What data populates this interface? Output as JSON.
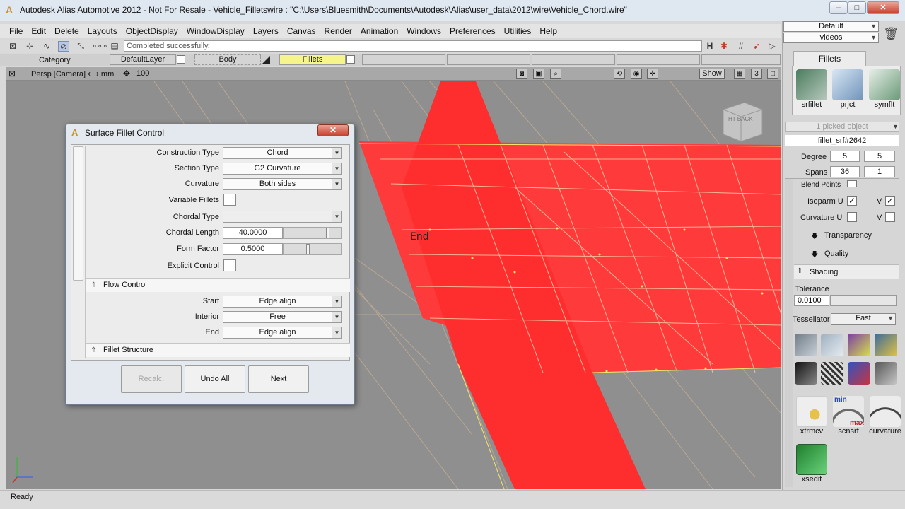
{
  "window": {
    "title": "Autodesk Alias Automotive 2012 - Not For Resale - Vehicle_Filletswire : \"C:\\Users\\Bluesmith\\Documents\\Autodesk\\Alias\\user_data\\2012\\wire\\Vehicle_Chord.wire\"",
    "minimize": "–",
    "maximize": "□",
    "close": "✕"
  },
  "menu": [
    "File",
    "Edit",
    "Delete",
    "Layouts",
    "ObjectDisplay",
    "WindowDisplay",
    "Layers",
    "Canvas",
    "Render",
    "Animation",
    "Windows",
    "Preferences",
    "Utilities",
    "Help"
  ],
  "toolbar": {
    "message": "Completed successfully."
  },
  "layers": {
    "category": "Category",
    "items": [
      "DefaultLayer",
      "Body",
      "Fillets"
    ]
  },
  "viewport": {
    "label": "Persp [Camera]  ⟷ mm",
    "zoom": "100",
    "show_button": "Show",
    "count": "3",
    "annotation": "End",
    "viewcube_text": "HT  BACK"
  },
  "status": {
    "text": "Ready"
  },
  "right_panel": {
    "shelf_default": "Default",
    "shelf_videos": "videos",
    "tab": "Fillets",
    "tools_top": [
      {
        "label": "srfillet",
        "color": "#5f8d6e"
      },
      {
        "label": "prjct",
        "color": "#8fb0cf"
      },
      {
        "label": "symflt",
        "color": "#7fa58a"
      }
    ],
    "picked": "1 picked object",
    "object_name": "fillet_srf#2642",
    "degree_label": "Degree",
    "degree_u": "5",
    "degree_v": "5",
    "spans_label": "Spans",
    "spans_u": "36",
    "spans_v": "1",
    "blend_points": "Blend Points",
    "isoparm_u": "Isoparm U",
    "isoparm_v": "V",
    "curvature_u": "Curvature U",
    "curvature_v": "V",
    "transparency": "Transparency",
    "quality": "Quality",
    "shading": "Shading",
    "tolerance_label": "Tolerance",
    "tolerance": "0.0100",
    "tessellator_label": "Tessellator",
    "tessellator": "Fast",
    "tools_bottom": [
      {
        "label": "xfrmcv"
      },
      {
        "label": "scnsrf"
      },
      {
        "label": "curvature"
      },
      {
        "label": "xsedit"
      }
    ],
    "scnsrf_min": "min",
    "scnsrf_max": "max"
  },
  "dialog": {
    "title": "Surface Fillet Control",
    "close": "✕",
    "fields": {
      "construction_type": {
        "label": "Construction Type",
        "value": "Chord"
      },
      "section_type": {
        "label": "Section Type",
        "value": "G2 Curvature"
      },
      "curvature": {
        "label": "Curvature",
        "value": "Both sides"
      },
      "variable_fillets": {
        "label": "Variable Fillets"
      },
      "chordal_type": {
        "label": "Chordal Type",
        "value": ""
      },
      "chordal_length": {
        "label": "Chordal Length",
        "value": "40.0000"
      },
      "form_factor": {
        "label": "Form Factor",
        "value": "0.5000"
      },
      "explicit_control": {
        "label": "Explicit Control"
      }
    },
    "flow_control": {
      "header": "Flow Control",
      "start": {
        "label": "Start",
        "value": "Edge align"
      },
      "interior": {
        "label": "Interior",
        "value": "Free"
      },
      "end": {
        "label": "End",
        "value": "Edge align"
      }
    },
    "fillet_structure": "Fillet Structure",
    "buttons": {
      "recalc": "Recalc.",
      "undo_all": "Undo All",
      "next": "Next"
    }
  }
}
